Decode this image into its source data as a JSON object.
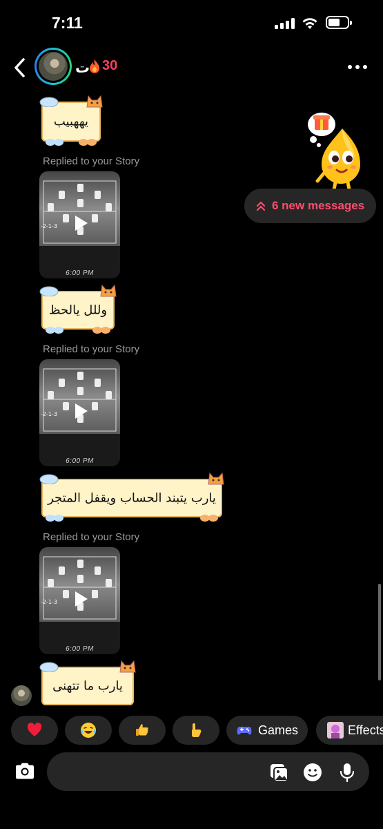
{
  "status_bar": {
    "time": "7:11"
  },
  "header": {
    "contact_name": "ت",
    "streak_count": "30",
    "back_icon": "chevron-left-icon",
    "more_icon": "more-horizontal-icon"
  },
  "messages": [
    {
      "type": "note",
      "text": "يههبيب"
    },
    {
      "type": "story_reply",
      "replied_label": "Replied to your Story",
      "story_caption": "6:00 PM"
    },
    {
      "type": "note",
      "text": "وللل يالحظ"
    },
    {
      "type": "story_reply",
      "replied_label": "Replied to your Story",
      "story_caption": "6:00 PM"
    },
    {
      "type": "note",
      "text": "يارب يتبند الحساب ويقفل المتجر"
    },
    {
      "type": "story_reply",
      "replied_label": "Replied to your Story",
      "story_caption": "6:00 PM"
    },
    {
      "type": "note",
      "text": "يارب ما تتهنى"
    }
  ],
  "new_messages": {
    "label": "6 new messages",
    "icon": "double-chevron-up-icon"
  },
  "quick_replies": [
    {
      "type": "emoji",
      "icon": "heart-emoji",
      "glyph": "❤️"
    },
    {
      "type": "emoji",
      "icon": "laughing-emoji",
      "glyph": "😂"
    },
    {
      "type": "emoji",
      "icon": "thumbs-up-emoji",
      "glyph": "👍"
    },
    {
      "type": "emoji",
      "icon": "pointing-up-emoji",
      "glyph": "👆"
    },
    {
      "type": "action",
      "icon": "gamepad-icon",
      "label": "Games"
    },
    {
      "type": "action",
      "icon": "effects-icon",
      "label": "Effects"
    }
  ],
  "composer": {
    "placeholder": "",
    "camera_icon": "camera-icon",
    "gallery_icon": "gallery-icon",
    "sticker_icon": "sticker-icon",
    "mic_icon": "microphone-icon"
  },
  "colors": {
    "background": "#000000",
    "accent_red": "#ff4d6d",
    "bubble_bg": "#262626",
    "note_bg": "#fff3c8"
  }
}
